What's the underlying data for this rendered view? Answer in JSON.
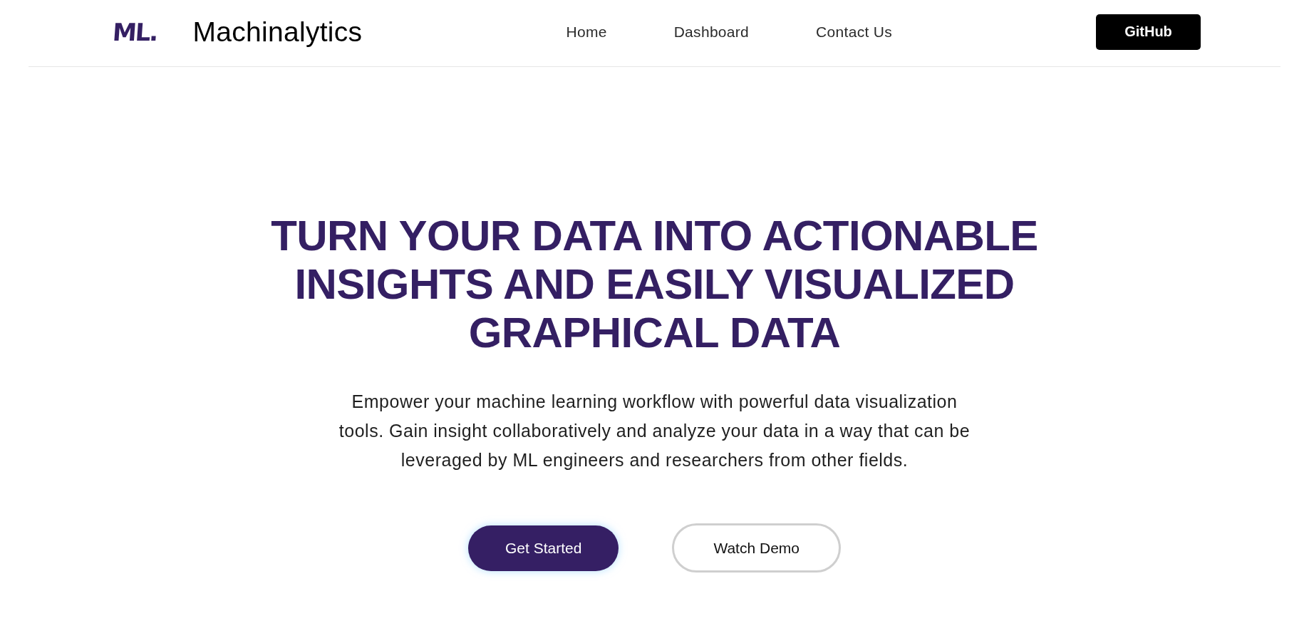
{
  "header": {
    "logo": "ML.",
    "brand": "Machinalytics",
    "nav": [
      {
        "label": "Home"
      },
      {
        "label": "Dashboard"
      },
      {
        "label": "Contact Us"
      }
    ],
    "github_button": "GitHub"
  },
  "hero": {
    "heading": "TURN YOUR DATA INTO ACTIONABLE INSIGHTS AND EASILY VISUALIZED GRAPHICAL DATA",
    "description": "Empower your machine learning workflow with powerful data visualization tools. Gain insight collaboratively and analyze your data in a way that can be leveraged by ML engineers and researchers from other fields.",
    "buttons": [
      {
        "label": "Get Started",
        "kind": "primary"
      },
      {
        "label": "Watch Demo",
        "kind": "outline"
      }
    ]
  }
}
